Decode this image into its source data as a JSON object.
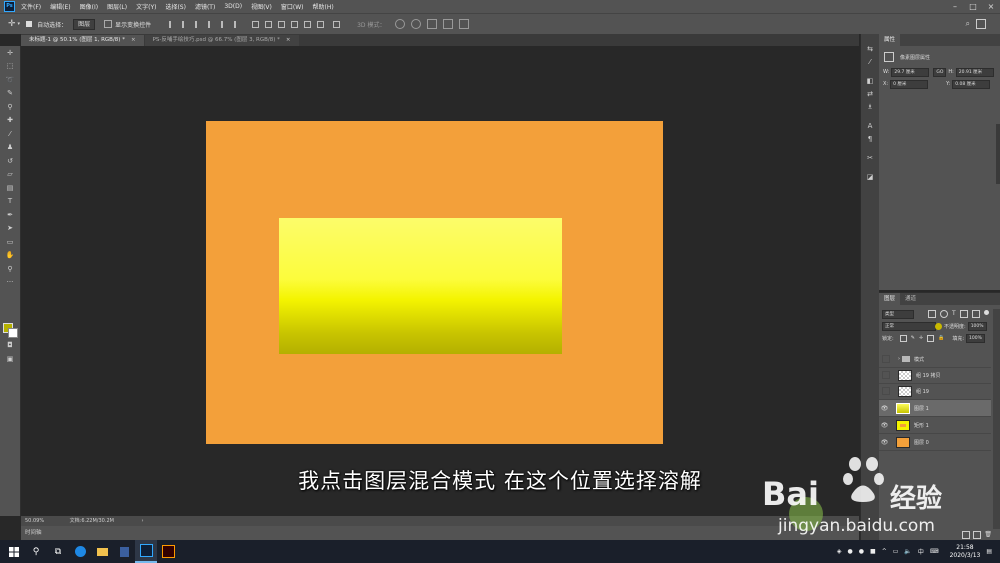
{
  "menu": {
    "logo": "Ps",
    "items": [
      "文件(F)",
      "编辑(E)",
      "图像(I)",
      "图层(L)",
      "文字(Y)",
      "选择(S)",
      "滤镜(T)",
      "3D(D)",
      "视图(V)",
      "窗口(W)",
      "帮助(H)"
    ]
  },
  "options": {
    "auto_select_label": "自动选择：",
    "auto_select_value": "图层",
    "show_transform_label": "显示变换控件",
    "mode_3d_label": "3D 模式："
  },
  "tabs": [
    {
      "label": "未标题-1 @ 50.1% (图层 1, RGB/8) *",
      "active": true
    },
    {
      "label": "PS-反哺手绘技巧.psd @ 66.7% (图层 3, RGB/8) *",
      "active": false
    }
  ],
  "colors": {
    "document_bg": "#f3a03a",
    "gradient_top": "#fcfc6a",
    "gradient_bottom": "#b4b000",
    "foreground": "#b5b100",
    "background": "#ffffff"
  },
  "subtitle": "我点击图层混合模式 在这个位置选择溶解",
  "status": {
    "zoom": "50.09%",
    "doc_size": "文档:6.22M/30.2M"
  },
  "timeline_label": "时间轴",
  "properties": {
    "tab": "属性",
    "title": "像素图层属性",
    "w_label": "W:",
    "w_value": "29.7 厘米",
    "link": "GO",
    "h_label": "H:",
    "h_value": "20.91 厘米",
    "x_label": "X:",
    "x_value": "0 厘米",
    "y_label": "Y:",
    "y_value": "0.08 厘米"
  },
  "layers": {
    "tabs": [
      "图层",
      "通道"
    ],
    "filter_label": "类型",
    "blend_mode": "正常",
    "opacity_label": "不透明度:",
    "opacity_value": "100%",
    "lock_label": "锁定:",
    "fill_label": "填充:",
    "fill_value": "100%",
    "items": [
      {
        "name": "模式",
        "visible": false,
        "type": "group"
      },
      {
        "name": "组 19 拷贝",
        "visible": false,
        "type": "checker"
      },
      {
        "name": "组 19",
        "visible": false,
        "type": "checker"
      },
      {
        "name": "图层 1",
        "visible": true,
        "type": "yellow",
        "selected": true
      },
      {
        "name": "矩形 1",
        "visible": true,
        "type": "rect"
      },
      {
        "name": "图层 0",
        "visible": true,
        "type": "orange"
      }
    ]
  },
  "watermark": {
    "brand": "Bai",
    "brand2": "经验",
    "url": "jingyan.baidu.com"
  },
  "taskbar": {
    "time": "21:58",
    "date": "2020/3/13",
    "lang": "中"
  }
}
